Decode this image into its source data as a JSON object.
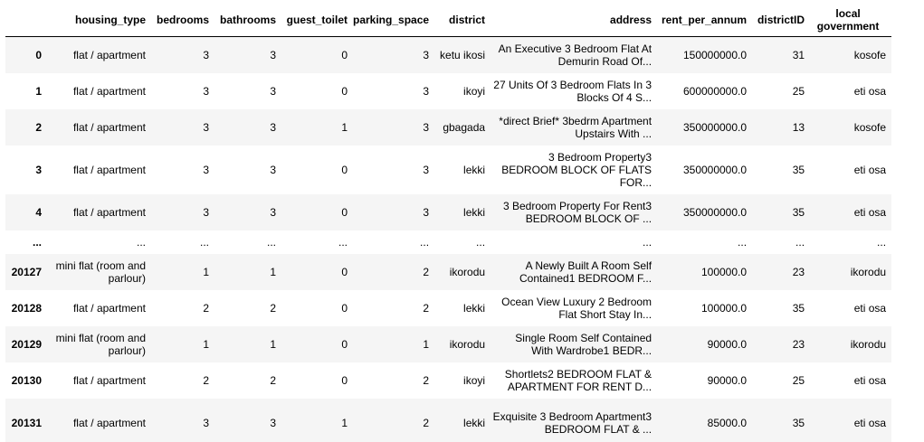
{
  "columns": [
    "",
    "housing_type",
    "bedrooms",
    "bathrooms",
    "guest_toilet",
    "parking_space",
    "district",
    "address",
    "rent_per_annum",
    "districtID",
    "local government"
  ],
  "rows": [
    {
      "index": "0",
      "housing_type": "flat / apartment",
      "bedrooms": "3",
      "bathrooms": "3",
      "guest_toilet": "0",
      "parking_space": "3",
      "district": "ketu ikosi",
      "address": "An Executive 3 Bedroom Flat At Demurin Road Of...",
      "rent_per_annum": "150000000.0",
      "districtID": "31",
      "local_government": "kosofe"
    },
    {
      "index": "1",
      "housing_type": "flat / apartment",
      "bedrooms": "3",
      "bathrooms": "3",
      "guest_toilet": "0",
      "parking_space": "3",
      "district": "ikoyi",
      "address": "27 Units Of 3 Bedroom Flats In 3 Blocks Of 4 S...",
      "rent_per_annum": "600000000.0",
      "districtID": "25",
      "local_government": "eti osa"
    },
    {
      "index": "2",
      "housing_type": "flat / apartment",
      "bedrooms": "3",
      "bathrooms": "3",
      "guest_toilet": "1",
      "parking_space": "3",
      "district": "gbagada",
      "address": "*direct Brief* 3bedrm Apartment Upstairs With ...",
      "rent_per_annum": "350000000.0",
      "districtID": "13",
      "local_government": "kosofe"
    },
    {
      "index": "3",
      "housing_type": "flat / apartment",
      "bedrooms": "3",
      "bathrooms": "3",
      "guest_toilet": "0",
      "parking_space": "3",
      "district": "lekki",
      "address": "3 Bedroom Property3 BEDROOM BLOCK OF FLATS FOR...",
      "rent_per_annum": "350000000.0",
      "districtID": "35",
      "local_government": "eti osa"
    },
    {
      "index": "4",
      "housing_type": "flat / apartment",
      "bedrooms": "3",
      "bathrooms": "3",
      "guest_toilet": "0",
      "parking_space": "3",
      "district": "lekki",
      "address": "3 Bedroom Property For Rent3 BEDROOM BLOCK OF ...",
      "rent_per_annum": "350000000.0",
      "districtID": "35",
      "local_government": "eti osa"
    },
    {
      "index": "...",
      "housing_type": "...",
      "bedrooms": "...",
      "bathrooms": "...",
      "guest_toilet": "...",
      "parking_space": "...",
      "district": "...",
      "address": "...",
      "rent_per_annum": "...",
      "districtID": "...",
      "local_government": "..."
    },
    {
      "index": "20127",
      "housing_type": "mini flat (room and parlour)",
      "bedrooms": "1",
      "bathrooms": "1",
      "guest_toilet": "0",
      "parking_space": "2",
      "district": "ikorodu",
      "address": "A Newly Built A Room Self Contained1 BEDROOM F...",
      "rent_per_annum": "100000.0",
      "districtID": "23",
      "local_government": "ikorodu"
    },
    {
      "index": "20128",
      "housing_type": "flat / apartment",
      "bedrooms": "2",
      "bathrooms": "2",
      "guest_toilet": "0",
      "parking_space": "2",
      "district": "lekki",
      "address": "Ocean View Luxury 2 Bedroom Flat Short Stay In...",
      "rent_per_annum": "100000.0",
      "districtID": "35",
      "local_government": "eti osa"
    },
    {
      "index": "20129",
      "housing_type": "mini flat (room and parlour)",
      "bedrooms": "1",
      "bathrooms": "1",
      "guest_toilet": "0",
      "parking_space": "1",
      "district": "ikorodu",
      "address": "Single Room Self Contained With Wardrobe1 BEDR...",
      "rent_per_annum": "90000.0",
      "districtID": "23",
      "local_government": "ikorodu"
    },
    {
      "index": "20130",
      "housing_type": "flat / apartment",
      "bedrooms": "2",
      "bathrooms": "2",
      "guest_toilet": "0",
      "parking_space": "2",
      "district": "ikoyi",
      "address": "Shortlets2 BEDROOM FLAT & APARTMENT FOR RENT D...",
      "rent_per_annum": "90000.0",
      "districtID": "25",
      "local_government": "eti osa"
    },
    {
      "index": "20131",
      "housing_type": "flat / apartment",
      "bedrooms": "3",
      "bathrooms": "3",
      "guest_toilet": "1",
      "parking_space": "2",
      "district": "lekki",
      "address": "Exquisite 3 Bedroom Apartment3 BEDROOM FLAT & ...",
      "rent_per_annum": "85000.0",
      "districtID": "35",
      "local_government": "eti osa"
    }
  ]
}
